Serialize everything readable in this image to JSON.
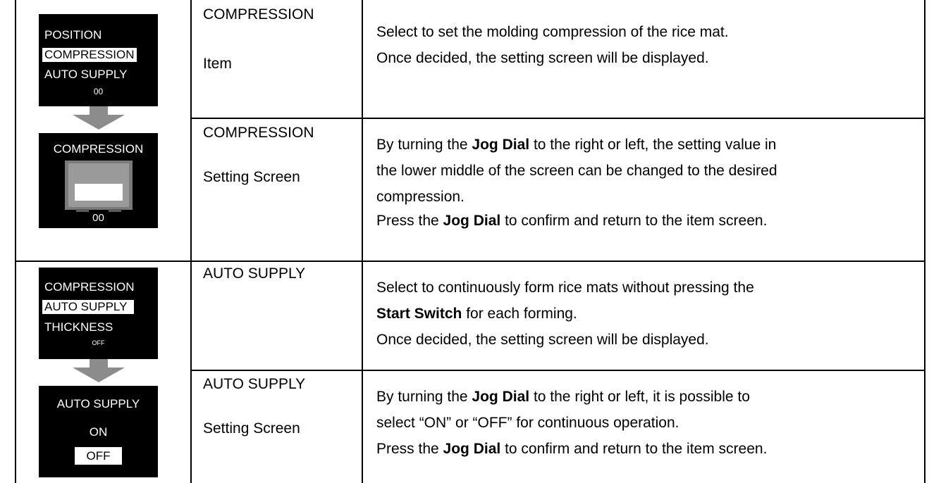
{
  "rows": [
    {
      "title": "COMPRESSION",
      "subtitle": "Item",
      "lines": [
        "Select to set the molding compression of the rice mat.",
        "Once decided, the setting screen will be displayed."
      ]
    },
    {
      "title": "COMPRESSION",
      "subtitle": "Setting Screen",
      "l1a": "By turning the ",
      "l1b": "Jog Dial",
      "l1c": " to the right or left, the setting value in",
      "l2": "the lower middle of the screen can be changed to the desired",
      "l3": "compression.",
      "l4a": "Press the ",
      "l4b": "Jog Dial",
      "l4c": " to confirm and return to the item screen."
    },
    {
      "title": "AUTO SUPPLY",
      "l1": "Select to continuously form rice mats without pressing the",
      "l2b": "Start Switch",
      "l2c": " for each forming.",
      "l3": "Once decided, the setting screen will be displayed."
    },
    {
      "title": "AUTO SUPPLY",
      "subtitle": "Setting Screen",
      "l1a": "By turning the ",
      "l1b": "Jog Dial",
      "l1c": " to the right or left, it is possible to",
      "l2": "select “ON” or “OFF” for continuous operation.",
      "l3a": "Press the ",
      "l3b": "Jog Dial",
      "l3c": " to confirm and return to the item screen."
    }
  ],
  "screens": {
    "s1": {
      "items": [
        "POSITION",
        "COMPRESSION",
        "AUTO SUPPLY"
      ],
      "value": "00"
    },
    "s2": {
      "title": "COMPRESSION",
      "value": "00"
    },
    "s3": {
      "items": [
        "COMPRESSION",
        "AUTO SUPPLY",
        "THICKNESS"
      ],
      "value": "OFF"
    },
    "s4": {
      "title": "AUTO SUPPLY",
      "opt_on": "ON",
      "opt_off": "OFF"
    }
  },
  "colors": {
    "arrow": "#8c8c8c",
    "screen_bg": "#000000"
  }
}
